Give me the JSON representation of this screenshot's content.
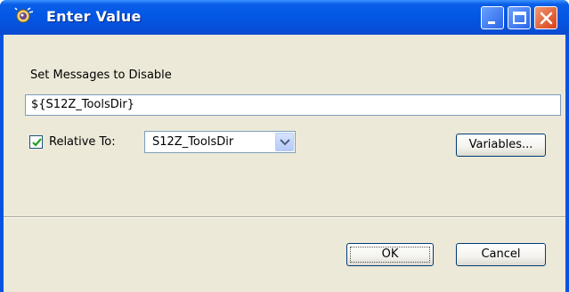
{
  "window": {
    "title": "Enter Value",
    "title_icon": "eclipse-wizard-icon",
    "controls": [
      "minimize-icon",
      "maximize-icon",
      "close-icon"
    ]
  },
  "form": {
    "header_label": "Set Messages to Disable",
    "path_value": "${S12Z_ToolsDir}",
    "relative": {
      "checked": true,
      "label": "Relative To:",
      "selected": "S12Z_ToolsDir"
    },
    "variables_button": "Variables..."
  },
  "buttons": {
    "ok": "OK",
    "cancel": "Cancel"
  },
  "colors": {
    "titlebar": "#0458e6",
    "dialog_bg": "#ece9d8",
    "close_button": "#d8401a"
  }
}
